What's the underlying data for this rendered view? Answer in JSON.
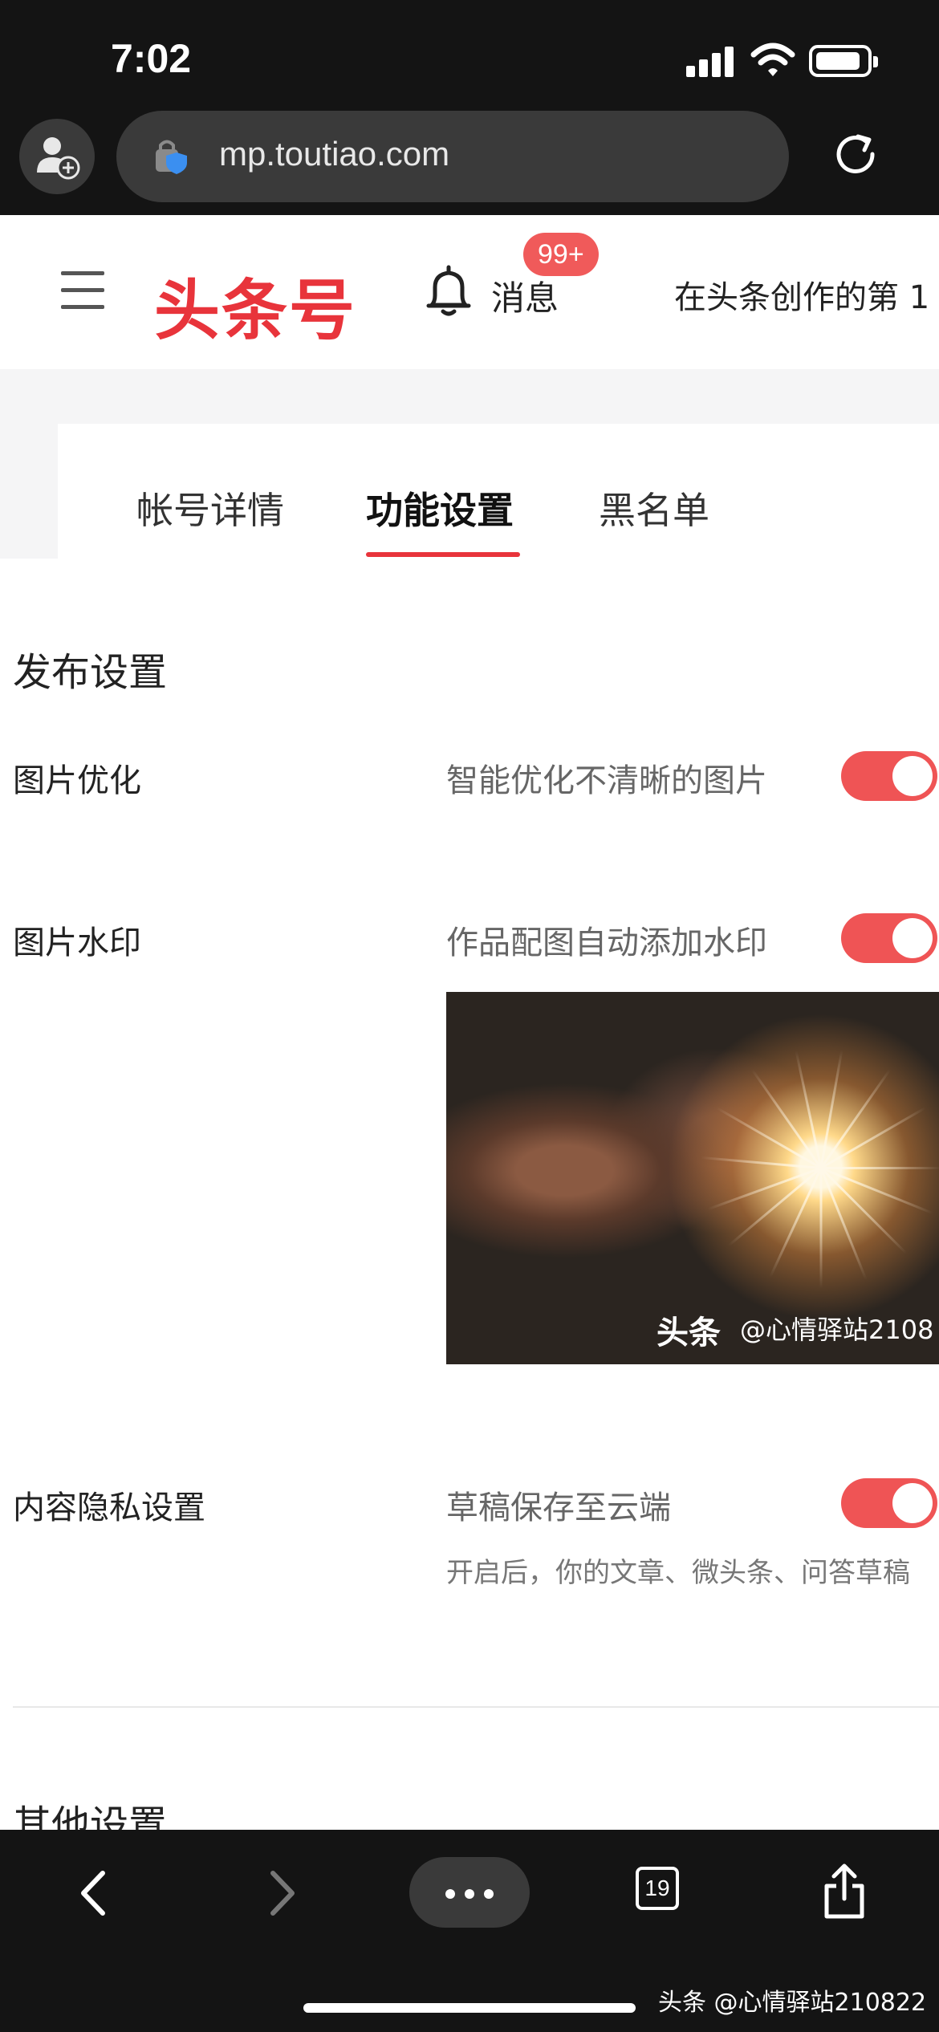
{
  "status_bar": {
    "time": "7:02"
  },
  "browser": {
    "url": "mp.toutiao.com",
    "tab_count": "19"
  },
  "header": {
    "logo": "头条号",
    "messages_label": "消息",
    "messages_badge": "99+",
    "slogan": "在头条创作的第 1"
  },
  "tabs": [
    {
      "label": "帐号详情",
      "active": false
    },
    {
      "label": "功能设置",
      "active": true
    },
    {
      "label": "黑名单",
      "active": false
    }
  ],
  "publish_settings": {
    "title": "发布设置",
    "image_optimization": {
      "label": "图片优化",
      "description": "智能优化不清晰的图片",
      "enabled": true
    },
    "image_watermark": {
      "label": "图片水印",
      "description": "作品配图自动添加水印",
      "enabled": true,
      "preview_logo": "头条",
      "preview_handle": "@心情驿站2108"
    },
    "content_privacy": {
      "label": "内容隐私设置",
      "description": "草稿保存至云端",
      "note": "开启后，你的文章、微头条、问答草稿",
      "enabled": true
    }
  },
  "other_settings": {
    "title": "其他设置"
  },
  "page_watermark": "头条 @心情驿站210822",
  "colors": {
    "accent": "#e8343b",
    "toggle_on": "#ef5455",
    "badge": "#f05a5a"
  }
}
